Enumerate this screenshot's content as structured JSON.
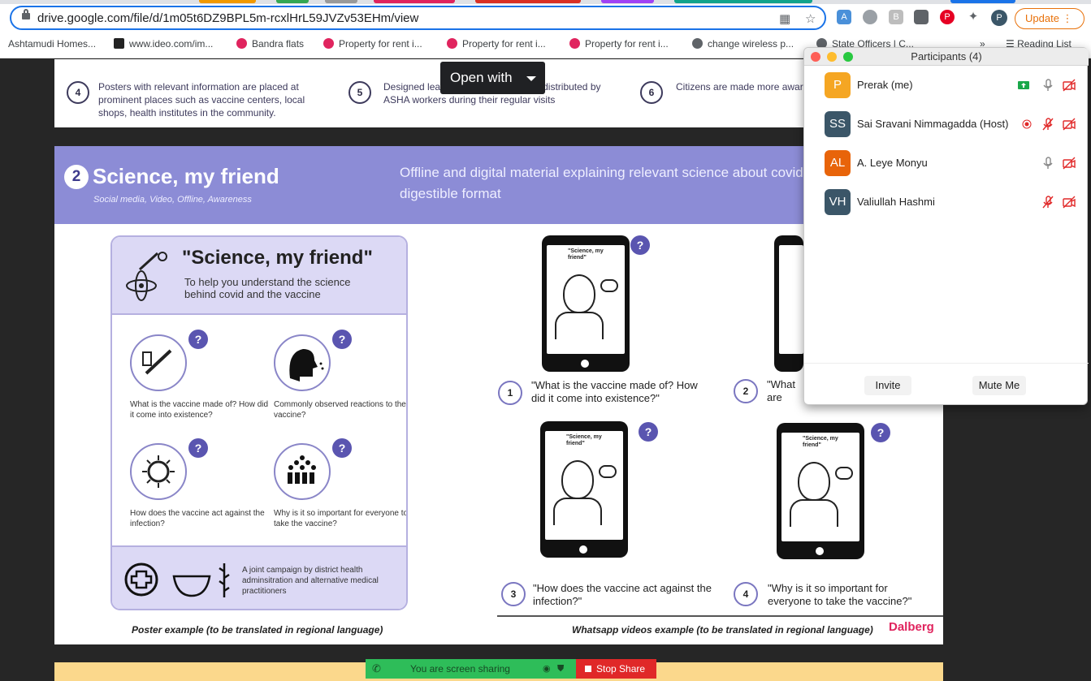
{
  "browser": {
    "url": "drive.google.com/file/d/1m05t6DZ9BPL5m-rcxlHrL59JVZv53EHm/view",
    "update_label": "Update",
    "profile_initial": "P",
    "bookmarks": [
      "Ashtamudi Homes...",
      "www.ideo.com/im...",
      "Bandra flats",
      "Property for rent i...",
      "Property for rent i...",
      "Property for rent i...",
      "change wireless p...",
      "State Officers | C..."
    ],
    "more_label": "»",
    "reading_list": "Reading List"
  },
  "viewer": {
    "open_with_label": "Open with"
  },
  "page1": {
    "steps": [
      {
        "num": "4",
        "text": "Posters with relevant information are placed at prominent places such as vaccine centers, local shops, health institutes in the community."
      },
      {
        "num": "5",
        "text": "Designed leaflets and brochures are distributed by ASHA workers during their regular visits"
      },
      {
        "num": "6",
        "text": "Citizens are made more aware of the vaccine"
      }
    ]
  },
  "section": {
    "number": "2",
    "title": "Science, my friend",
    "subtitle": "Social media, Video, Offline, Awareness",
    "description": "Offline and digital material explaining relevant science about covid in a digestible format"
  },
  "poster": {
    "title": "\"Science, my friend\"",
    "subtitle": "To help you understand the science behind covid and the vaccine",
    "questions": [
      "What is the vaccine made of? How did it come into existence?",
      "Commonly observed reactions to the vaccine?",
      "How does the vaccine act against the infection?",
      "Why is it so important for everyone to take the vaccine?"
    ],
    "question_mark": "?",
    "campaign": "A joint campaign by district health adminsitration and alternative medical practitioners",
    "caption": "Poster example (to be translated in regional language)"
  },
  "videos": {
    "phone_label": "\"Science, my friend\"",
    "items": [
      {
        "num": "1",
        "text": "\"What is the vaccine made of? How did it come into existence?\""
      },
      {
        "num": "2",
        "text": "\"What are the commonly observed reactions?\""
      },
      {
        "num": "3",
        "text": "\"How does the vaccine act against the infection?\""
      },
      {
        "num": "4",
        "text": "\"Why is it so important for everyone to take the vaccine?\""
      }
    ],
    "caption": "Whatsapp videos example (to be translated in regional language)",
    "logo": "Dalberg"
  },
  "zoom": {
    "title": "Participants (4)",
    "participants": [
      {
        "initials": "P",
        "name": "Prerak (me)",
        "color": "#f5a623"
      },
      {
        "initials": "SS",
        "name": "Sai Sravani Nimmagadda (Host)",
        "color": "#3b5668"
      },
      {
        "initials": "AL",
        "name": "A. Leye Monyu",
        "color": "#e8640a"
      },
      {
        "initials": "VH",
        "name": "Valiullah Hashmi",
        "color": "#3b5668"
      }
    ],
    "invite_label": "Invite",
    "mute_label": "Mute Me"
  },
  "share_bar": {
    "status": "You are screen sharing",
    "stop_label": "Stop Share"
  },
  "colors": {
    "accent": "#1a73e8",
    "section_band": "#8c8cd6",
    "share_green": "#2ebd59",
    "stop_red": "#e02828"
  }
}
